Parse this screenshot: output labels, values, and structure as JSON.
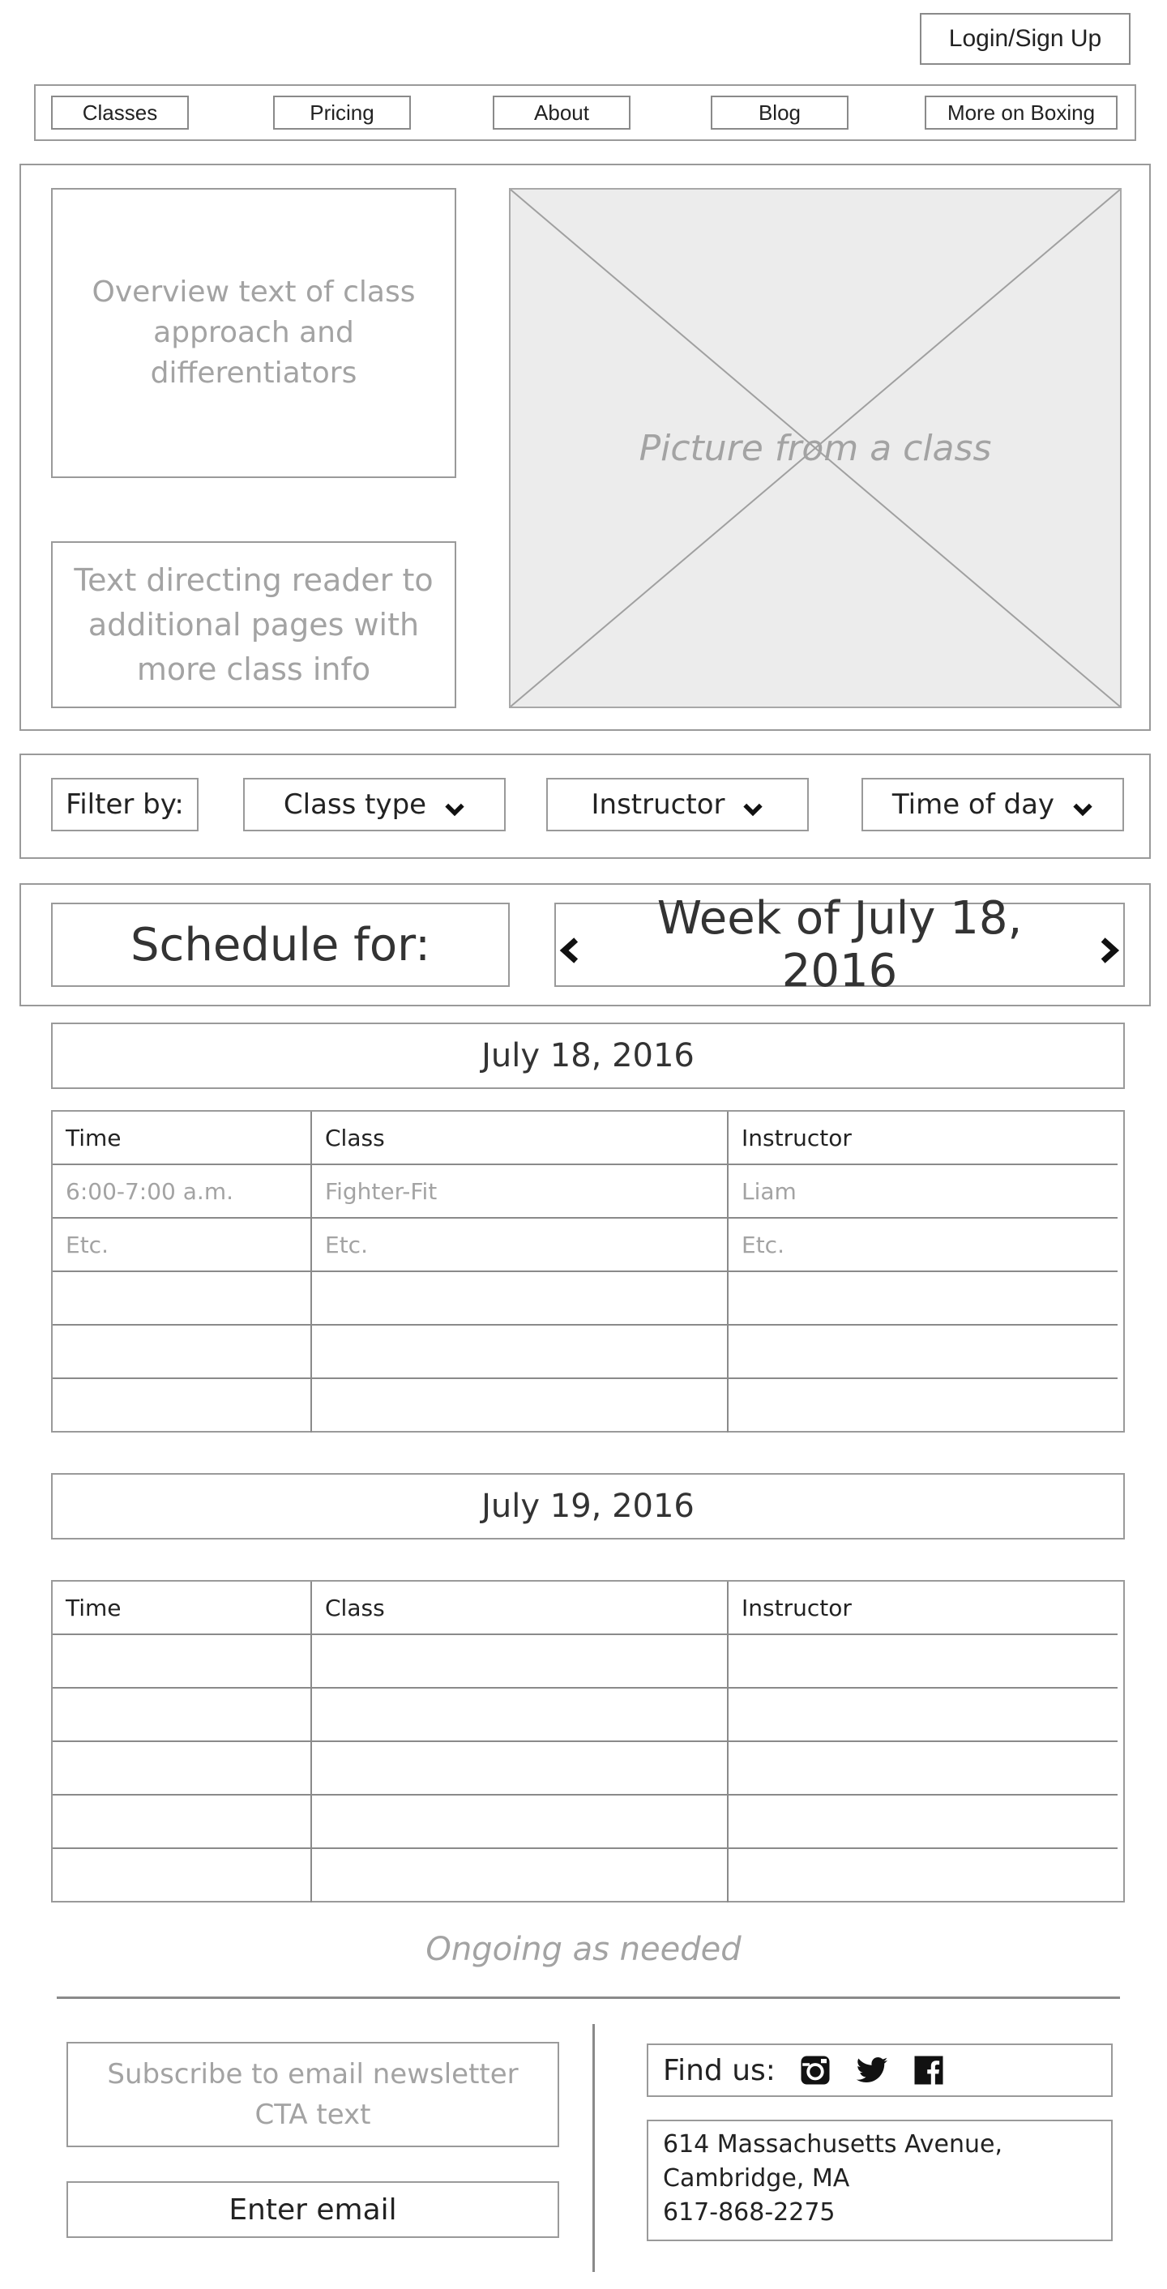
{
  "header": {
    "login_label": "Login/Sign Up"
  },
  "nav": {
    "items": [
      {
        "label": "Classes"
      },
      {
        "label": "Pricing"
      },
      {
        "label": "About"
      },
      {
        "label": "Blog"
      },
      {
        "label": "More on Boxing"
      }
    ]
  },
  "hero": {
    "overview_text": "Overview text of class approach and differentiators",
    "directing_text": "Text directing reader to additional pages with more class info",
    "image_caption": "Picture from a class"
  },
  "filter": {
    "label": "Filter by:",
    "class_type": "Class type",
    "instructor": "Instructor",
    "time_of_day": "Time of day"
  },
  "schedule": {
    "label": "Schedule for:",
    "week": "Week of July 18, 2016",
    "days": [
      {
        "date": "July 18, 2016",
        "headers": [
          "Time",
          "Class",
          "Instructor"
        ],
        "rows": [
          [
            "6:00-7:00 a.m.",
            "Fighter-Fit",
            "Liam"
          ],
          [
            "Etc.",
            "Etc.",
            "Etc."
          ],
          [
            "",
            "",
            ""
          ],
          [
            "",
            "",
            ""
          ],
          [
            "",
            "",
            ""
          ]
        ]
      },
      {
        "date": "July 19, 2016",
        "headers": [
          "Time",
          "Class",
          "Instructor"
        ],
        "rows": [
          [
            "",
            "",
            ""
          ],
          [
            "",
            "",
            ""
          ],
          [
            "",
            "",
            ""
          ],
          [
            "",
            "",
            ""
          ],
          [
            "",
            "",
            ""
          ]
        ]
      }
    ],
    "ongoing_text": "Ongoing as needed"
  },
  "footer": {
    "newsletter_text": "Subscribe to email newsletter CTA text",
    "email_placeholder": "Enter email",
    "find_us_label": "Find us:",
    "social": [
      "instagram-icon",
      "twitter-icon",
      "facebook-icon"
    ],
    "address_line1": "614 Massachusetts Avenue,",
    "address_line2": "Cambridge, MA",
    "phone": "617-868-2275"
  },
  "colors": {
    "border": "#9a9a9a",
    "placeholder_text": "#a3a3a3",
    "image_fill": "#ececec"
  }
}
